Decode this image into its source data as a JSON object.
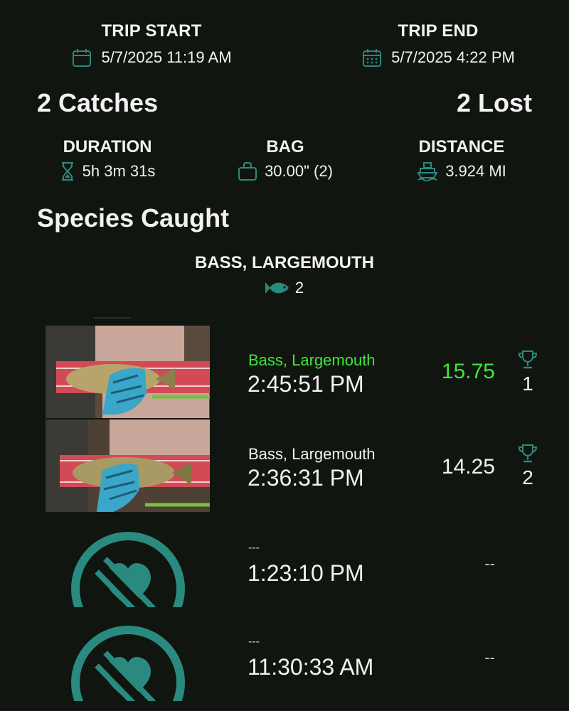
{
  "trip": {
    "start_label": "TRIP START",
    "start_value": "5/7/2025 11:19 AM",
    "end_label": "TRIP END",
    "end_value": "5/7/2025 4:22 PM"
  },
  "summary": {
    "catches": "2 Catches",
    "lost": "2 Lost"
  },
  "stats": {
    "duration_label": "DURATION",
    "duration_value": "5h 3m 31s",
    "bag_label": "BAG",
    "bag_value": "30.00\" (2)",
    "distance_label": "DISTANCE",
    "distance_value": "3.924 MI"
  },
  "species_section": {
    "title": "Species Caught",
    "species": [
      {
        "name": "BASS, LARGEMOUTH",
        "count": "2"
      }
    ]
  },
  "catches": [
    {
      "species": "Bass, Largemouth",
      "time": "2:45:51 PM",
      "length": "15.75",
      "rank": "1",
      "highlight": true
    },
    {
      "species": "Bass, Largemouth",
      "time": "2:36:31 PM",
      "length": "14.25",
      "rank": "2",
      "highlight": false
    }
  ],
  "lost": [
    {
      "species": "---",
      "time": "1:23:10 PM",
      "length": "--"
    },
    {
      "species": "---",
      "time": "11:30:33 AM",
      "length": "--"
    }
  ],
  "colors": {
    "background": "#11150f",
    "accent_teal": "#2a8a80",
    "highlight_green": "#3ee63a"
  }
}
